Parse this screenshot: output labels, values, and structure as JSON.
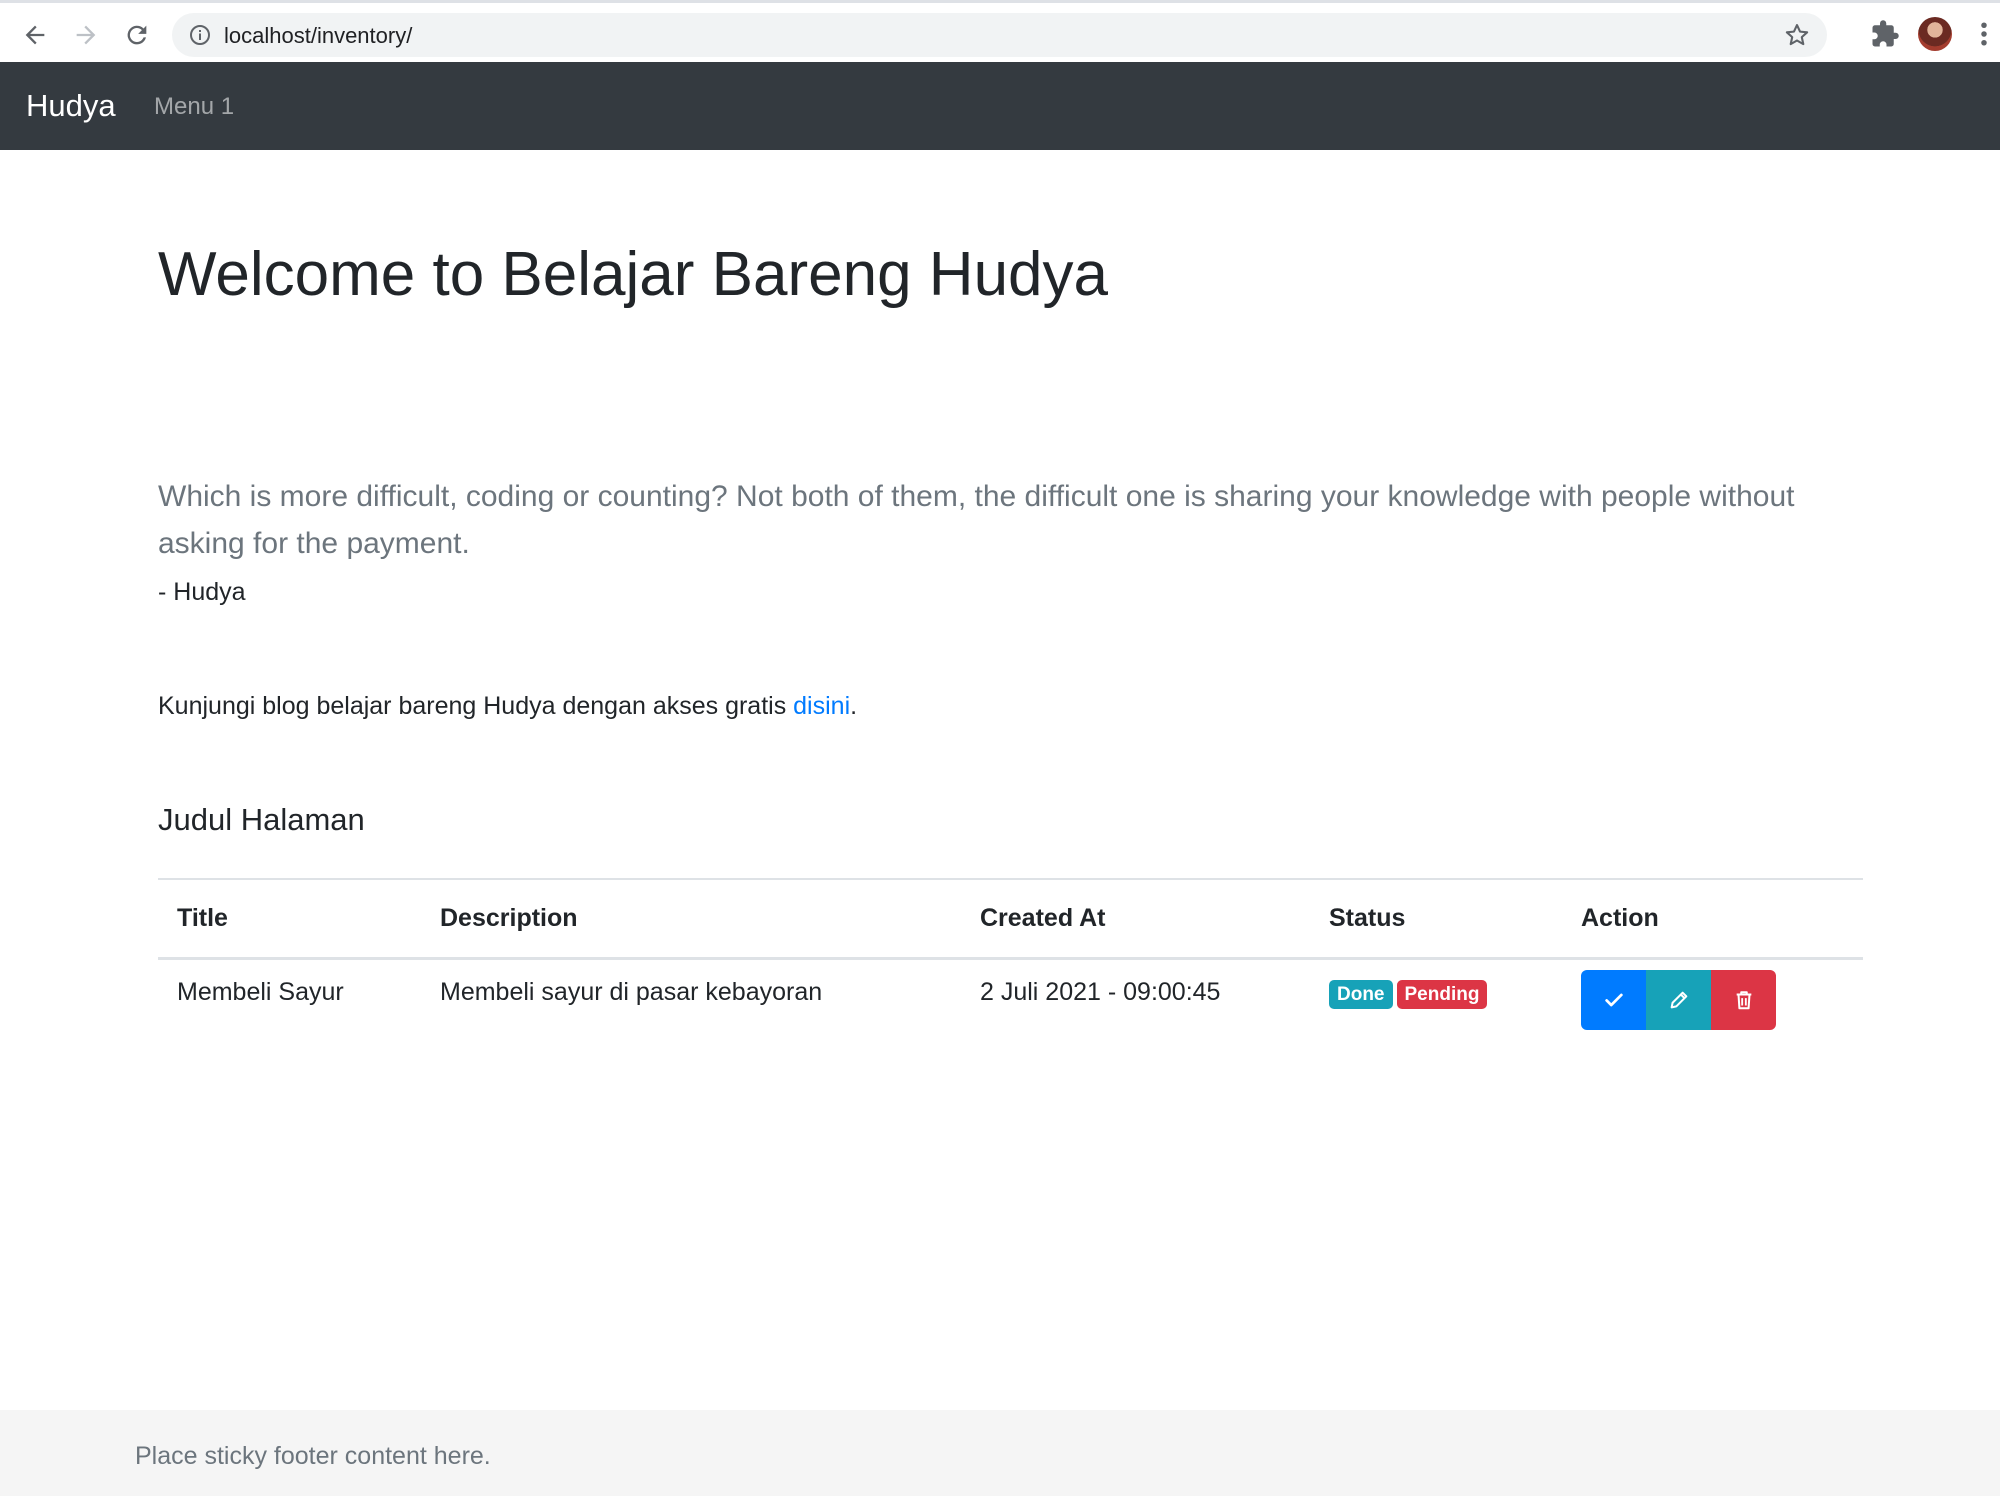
{
  "browser": {
    "url": "localhost/inventory/"
  },
  "navbar": {
    "brand": "Hudya",
    "menu_item": "Menu 1"
  },
  "jumbotron": {
    "title": "Welcome to Belajar Bareng Hudya",
    "lead": "Which is more difficult, coding or counting? Not both of them, the difficult one is sharing your knowledge with people without asking for the payment.",
    "author": "- Hudya"
  },
  "blog": {
    "text": "Kunjungi blog belajar bareng Hudya dengan akses gratis ",
    "link_text": "disini",
    "suffix": "."
  },
  "section": {
    "title": "Judul Halaman"
  },
  "table": {
    "headers": [
      "Title",
      "Description",
      "Created At",
      "Status",
      "Action"
    ],
    "rows": [
      {
        "title": "Membeli Sayur",
        "description": "Membeli sayur di pasar kebayoran",
        "created_at": "2 Juli 2021 - 09:00:45",
        "badges": [
          "Done",
          "Pending"
        ]
      }
    ]
  },
  "footer": {
    "text": "Place sticky footer content here."
  },
  "colors": {
    "navbar_bg": "#343a40",
    "primary": "#007bff",
    "info": "#17a2b8",
    "danger": "#dc3545",
    "footer_bg": "#f5f5f5"
  },
  "icons": {
    "back": "arrow-left-icon",
    "forward": "arrow-right-icon",
    "reload": "reload-icon",
    "site_info": "info-icon",
    "bookmark": "star-icon",
    "extensions": "puzzle-icon",
    "menu": "kebab-icon",
    "done_action": "check-icon",
    "edit_action": "pencil-icon",
    "delete_action": "trash-icon"
  }
}
